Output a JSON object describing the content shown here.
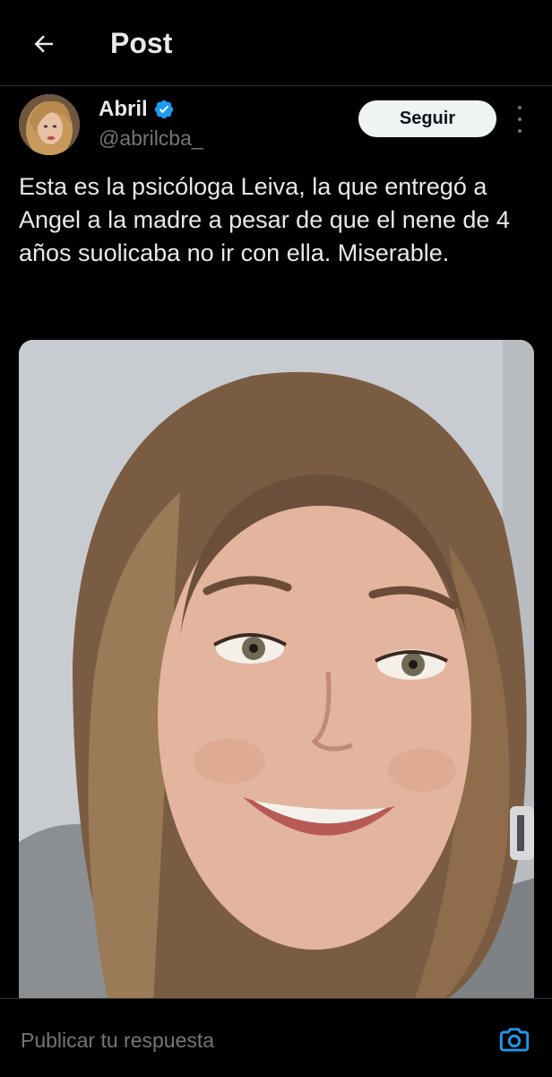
{
  "header": {
    "title": "Post",
    "back_icon": "arrow-left-icon"
  },
  "author": {
    "name": "Abril",
    "handle": "@abrilcba_",
    "verified_icon": "verified-badge-icon",
    "verified_color": "#1d9bf0"
  },
  "actions": {
    "follow_label": "Seguir",
    "more_icon": "more-vertical-icon"
  },
  "post": {
    "text": "Esta es la psicóloga Leiva, la que entregó a Angel a la madre a pesar de que el nene de 4 años suolicaba no ir con ella. Miserable.",
    "media_type": "photo"
  },
  "reply": {
    "placeholder": "Publicar tu respuesta",
    "camera_icon": "camera-icon",
    "accent": "#1d9bf0"
  }
}
